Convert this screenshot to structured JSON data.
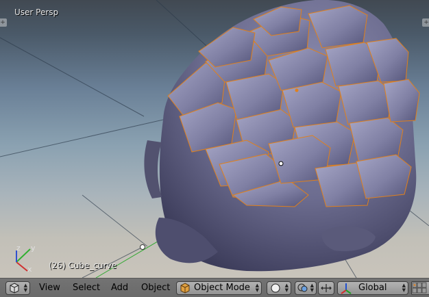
{
  "viewport": {
    "view_label": "User Persp",
    "active_object": "(26) Cube_curve",
    "axes": {
      "x": "x",
      "y": "y",
      "z": "z"
    }
  },
  "header": {
    "menus": [
      "View",
      "Select",
      "Add",
      "Object"
    ],
    "mode": "Object Mode",
    "orientation": "Global"
  },
  "colors": {
    "object_outline": "#e0801c",
    "mesh": "#6e6e8e",
    "header": "#6e6e6e"
  },
  "icons": {
    "editor_type": "cube-icon",
    "mode": "object-mode-icon",
    "shading": "sphere-icon",
    "pivot": "pivot-icon",
    "manipulator": "transform-arrows-icon",
    "orientation_gizmo": "axis-gizmo-icon",
    "layers": "layers-icon"
  }
}
